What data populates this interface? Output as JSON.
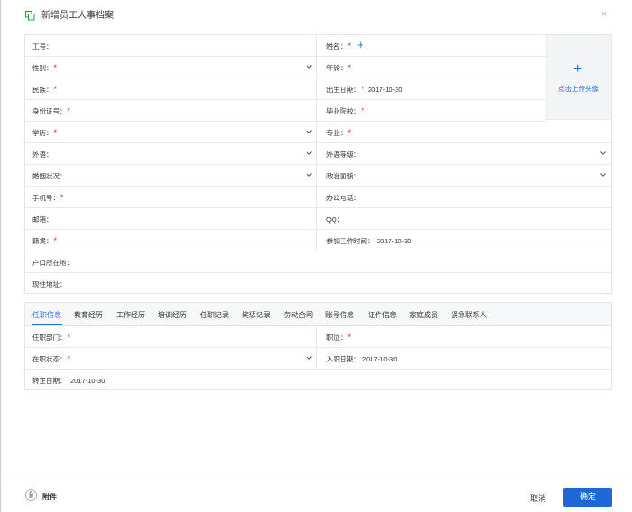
{
  "dialog": {
    "title": "新增员工人事档案",
    "close_glyph": "×",
    "header_icon": "copy-squares-icon",
    "accent_color": "#2a6fdb"
  },
  "form": {
    "fields": {
      "employee_no": {
        "label": "工号："
      },
      "name": {
        "label": "姓名：",
        "required": "*"
      },
      "gender": {
        "label": "性别：",
        "required": "*"
      },
      "age": {
        "label": "年龄：",
        "required": "*"
      },
      "ethnicity": {
        "label": "民族：",
        "required": "*"
      },
      "birth_date": {
        "label": "出生日期：",
        "required": "*",
        "value": "2017-10-30"
      },
      "id_number": {
        "label": "身份证号：",
        "required": "*"
      },
      "graduated_school": {
        "label": "毕业院校：",
        "required": "*"
      },
      "education": {
        "label": "学历：",
        "required": "*"
      },
      "major": {
        "label": "专业：",
        "required": "*"
      },
      "foreign_language": {
        "label": "外语："
      },
      "language_level": {
        "label": "外语等级："
      },
      "marital_status": {
        "label": "婚姻状况："
      },
      "political_status": {
        "label": "政治面貌："
      },
      "mobile": {
        "label": "手机号：",
        "required": "*"
      },
      "office_phone": {
        "label": "办公电话："
      },
      "email": {
        "label": "邮箱："
      },
      "qq": {
        "label": "QQ："
      },
      "native_place": {
        "label": "籍贯：",
        "required": "*"
      },
      "work_start_date": {
        "label": "参加工作时间：",
        "value": "2017-10-30"
      },
      "hukou_address": {
        "label": "户口所在地："
      },
      "current_address": {
        "label": "现住地址："
      }
    },
    "avatar_upload": {
      "plus": "+",
      "label": "点击上传头像"
    },
    "add_glyph": "+"
  },
  "tabs": {
    "items": [
      "任职信息",
      "教育经历",
      "工作经历",
      "培训经历",
      "任职记录",
      "奖惩记录",
      "劳动合同",
      "账号信息",
      "证件信息",
      "家庭成员",
      "紧急联系人"
    ],
    "active": "任职信息",
    "employment": {
      "department": {
        "label": "任职部门：",
        "required": "*"
      },
      "position": {
        "label": "职位：",
        "required": "*"
      },
      "employment_status": {
        "label": "在职状态：",
        "required": "*"
      },
      "hire_date": {
        "label": "入职日期：",
        "value": "2017-10-30"
      },
      "regular_date": {
        "label": "转正日期：",
        "value": "2017-10-30"
      }
    }
  },
  "footer": {
    "attachment_label": "附件",
    "cancel_label": "取消",
    "confirm_label": "确定"
  }
}
